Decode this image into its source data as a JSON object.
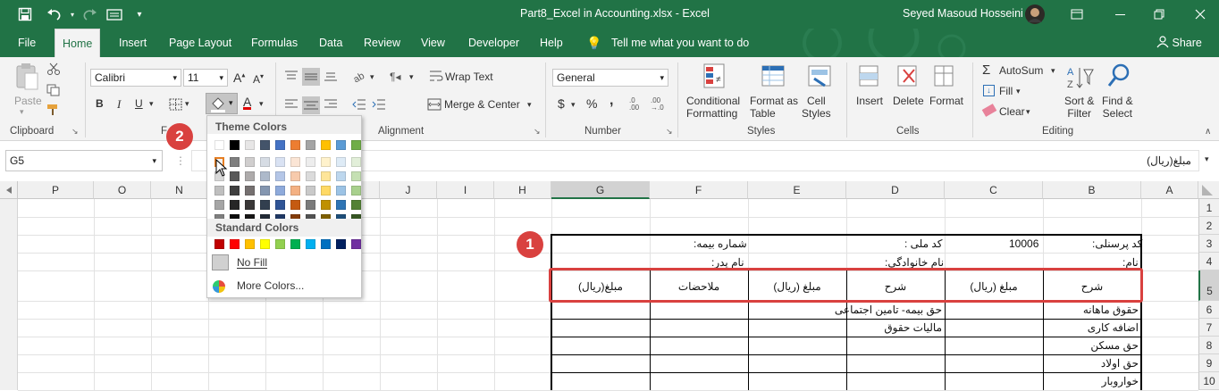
{
  "titlebar": {
    "filename": "Part8_Excel in Accounting.xlsx",
    "separator": "-",
    "app": "Excel",
    "user": "Seyed Masoud Hosseini",
    "icons": [
      "save-icon",
      "undo-icon",
      "redo-icon",
      "form-icon",
      "customize-qat-icon",
      "ribbon-display-icon",
      "minimize-icon",
      "restore-icon",
      "close-icon"
    ]
  },
  "tabs": [
    "File",
    "Home",
    "Insert",
    "Page Layout",
    "Formulas",
    "Data",
    "Review",
    "View",
    "Developer",
    "Help"
  ],
  "tell_me": "Tell me what you want to do",
  "share": "Share",
  "ribbon": {
    "clipboard": {
      "paste": "Paste",
      "label": "Clipboard"
    },
    "font": {
      "name": "Calibri",
      "size": "11",
      "bold": "B",
      "italic": "I",
      "underline": "U",
      "label_fragment": "F"
    },
    "alignment": {
      "wrap": "Wrap Text",
      "merge": "Merge & Center",
      "label": "Alignment"
    },
    "number": {
      "format": "General",
      "currency": "$",
      "percent": "%",
      "comma": ",",
      "label": "Number"
    },
    "styles": {
      "conditional": [
        "Conditional",
        "Formatting"
      ],
      "format_table": [
        "Format as",
        "Table"
      ],
      "cell_styles": [
        "Cell",
        "Styles"
      ],
      "label": "Styles"
    },
    "cells": {
      "insert": "Insert",
      "delete": "Delete",
      "format": "Format",
      "label": "Cells"
    },
    "editing": {
      "autosum": "AutoSum",
      "fill": "Fill",
      "clear": "Clear",
      "sort": [
        "Sort &",
        "Filter"
      ],
      "find": [
        "Find &",
        "Select"
      ],
      "label": "Editing"
    }
  },
  "formula_bar": {
    "name_box": "G5",
    "fx": "fx",
    "content": "مبلغ(ریال)"
  },
  "columns": [
    "P",
    "O",
    "N",
    "M",
    "L",
    "K",
    "J",
    "I",
    "H",
    "G",
    "F",
    "E",
    "D",
    "C",
    "B",
    "A"
  ],
  "rows": [
    "1",
    "2",
    "3",
    "4",
    "5",
    "6",
    "7",
    "8",
    "9",
    "10"
  ],
  "sheet": {
    "row3": {
      "b": "کد پرسنلی:",
      "c": "10006",
      "d": "کد ملی :",
      "f": "شماره بیمه:"
    },
    "row4": {
      "b": "نام:",
      "d": "نام خانوادگی:",
      "f": "نام پدر:"
    },
    "headers": [
      "شرح",
      "مبلغ (ریال)",
      "شرح",
      "مبلغ (ریال)",
      "ملاحضات",
      "مبلغ(ریال)"
    ],
    "items_b": [
      "حقوق ماهانه",
      "اضافه کاری",
      "حق مسکن",
      "حق اولاد",
      "خواروبار"
    ],
    "items_d": [
      "حق بیمه- تامین اجتماعی",
      "مالیات حقوق"
    ]
  },
  "picker": {
    "theme_title": "Theme Colors",
    "standard_title": "Standard Colors",
    "no_fill": "No Fill",
    "more_colors": "More Colors...",
    "theme_top": [
      "#ffffff",
      "#000000",
      "#e7e6e6",
      "#44546a",
      "#4472c4",
      "#ed7d31",
      "#a5a5a5",
      "#ffc000",
      "#5b9bd5",
      "#70ad47"
    ],
    "theme_shades": [
      [
        "#f2f2f2",
        "#7f7f7f",
        "#d0cece",
        "#d6dce4",
        "#d9e2f3",
        "#fbe5d5",
        "#ededed",
        "#fff2cc",
        "#deebf6",
        "#e2efd9"
      ],
      [
        "#d8d8d8",
        "#595959",
        "#aeabab",
        "#adb9ca",
        "#b4c6e7",
        "#f7caac",
        "#dbdbdb",
        "#fee599",
        "#bdd7ee",
        "#c5e0b3"
      ],
      [
        "#bfbfbf",
        "#3f3f3f",
        "#757070",
        "#8496b0",
        "#8eaadb",
        "#f4b183",
        "#c9c9c9",
        "#ffd965",
        "#9cc3e5",
        "#a8d08d"
      ],
      [
        "#a5a5a5",
        "#262626",
        "#3a3838",
        "#323f4f",
        "#2f5496",
        "#c55a11",
        "#7b7b7b",
        "#bf9000",
        "#2e75b5",
        "#538135"
      ],
      [
        "#7f7f7f",
        "#0c0c0c",
        "#171616",
        "#222a35",
        "#1f3864",
        "#833c0b",
        "#525252",
        "#7f6000",
        "#1e4e79",
        "#375623"
      ]
    ],
    "standard": [
      "#c00000",
      "#ff0000",
      "#ffc000",
      "#ffff00",
      "#92d050",
      "#00b050",
      "#00b0f0",
      "#0070c0",
      "#002060",
      "#7030a0"
    ]
  },
  "badges": [
    "1",
    "2"
  ],
  "accent": "#217346",
  "highlight": "#d9413f"
}
